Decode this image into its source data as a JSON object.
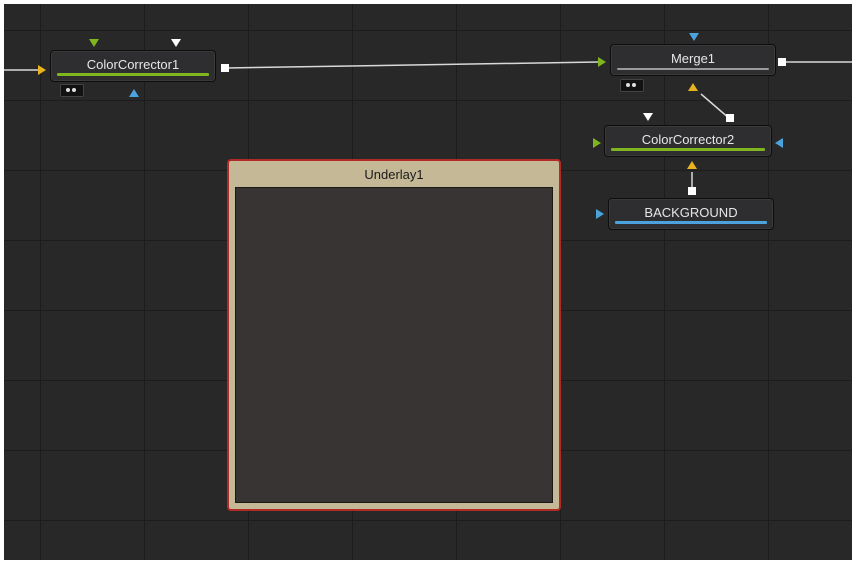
{
  "nodes": {
    "color_corrector_1": {
      "label": "ColorCorrector1",
      "bar_color": "#7fb51f"
    },
    "merge_1": {
      "label": "Merge1",
      "bar_color": "#9a9a9a"
    },
    "color_corrector_2": {
      "label": "ColorCorrector2",
      "bar_color": "#7fb51f"
    },
    "background": {
      "label": "BACKGROUND",
      "bar_color": "#4aa3dc"
    }
  },
  "underlay": {
    "title": "Underlay1",
    "border_color": "#b22a25",
    "fill_color": "#c4b896"
  },
  "colors": {
    "canvas": "#282828",
    "grid": "#1c1c1c",
    "input_yellow": "#e8b31e",
    "input_green": "#7fb51f",
    "input_blue": "#4aa3dc",
    "output_white": "#ffffff"
  }
}
